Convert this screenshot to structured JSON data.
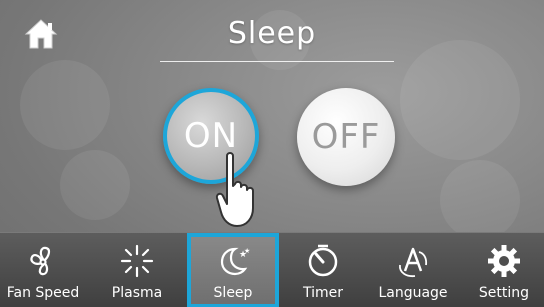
{
  "screen": {
    "title": "Sleep",
    "home_icon": "home-icon"
  },
  "toggle": {
    "on_label": "ON",
    "off_label": "OFF",
    "selected": "ON",
    "accent_color": "#1da6d9"
  },
  "dock": {
    "items": [
      {
        "label": "Fan Speed",
        "icon": "fan-icon"
      },
      {
        "label": "Plasma",
        "icon": "plasma-icon"
      },
      {
        "label": "Sleep",
        "icon": "moon-stars-icon",
        "active": true
      },
      {
        "label": "Timer",
        "icon": "timer-icon"
      },
      {
        "label": "Language",
        "icon": "language-icon"
      },
      {
        "label": "Setting",
        "icon": "gear-icon"
      }
    ]
  }
}
